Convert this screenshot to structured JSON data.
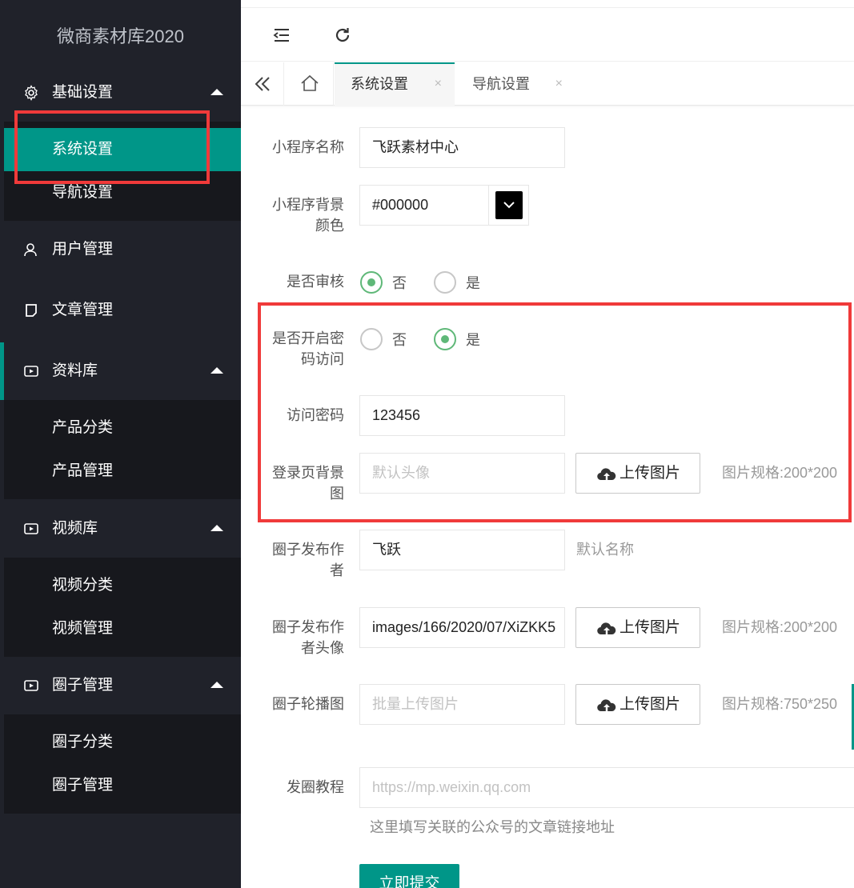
{
  "app": {
    "title": "微商素材库2020"
  },
  "sidebar": {
    "groups": [
      {
        "label": "基础设置",
        "items": [
          {
            "label": "系统设置"
          },
          {
            "label": "导航设置"
          }
        ]
      },
      {
        "label": "用户管理"
      },
      {
        "label": "文章管理"
      },
      {
        "label": "资料库",
        "items": [
          {
            "label": "产品分类"
          },
          {
            "label": "产品管理"
          }
        ]
      },
      {
        "label": "视频库",
        "items": [
          {
            "label": "视频分类"
          },
          {
            "label": "视频管理"
          }
        ]
      },
      {
        "label": "圈子管理",
        "items": [
          {
            "label": "圈子分类"
          },
          {
            "label": "圈子管理"
          }
        ]
      }
    ]
  },
  "tabs": [
    {
      "label": "系统设置",
      "close": "×"
    },
    {
      "label": "导航设置",
      "close": "×"
    }
  ],
  "form": {
    "app_name": {
      "label": "小程序名称",
      "value": "飞跃素材中心"
    },
    "bg_color": {
      "label_line1": "小程序背景",
      "label_line2": "颜色",
      "value": "#000000"
    },
    "review": {
      "label": "是否审核",
      "options": [
        "否",
        "是"
      ],
      "selected": "否"
    },
    "password_access": {
      "label_line1": "是否开启密",
      "label_line2": "码访问",
      "options": [
        "否",
        "是"
      ],
      "selected": "是"
    },
    "access_password": {
      "label": "访问密码",
      "value": "123456"
    },
    "login_bg": {
      "label_line1": "登录页背景",
      "label_line2": "图",
      "placeholder": "默认头像",
      "button": "上传图片",
      "hint": "图片规格:200*200"
    },
    "circle_author": {
      "label_line1": "圈子发布作",
      "label_line2": "者",
      "value": "飞跃",
      "hint": "默认名称"
    },
    "circle_author_avatar": {
      "label_line1": "圈子发布作",
      "label_line2": "者头像",
      "value": "images/166/2020/07/XiZKK5",
      "button": "上传图片",
      "hint": "图片规格:200*200"
    },
    "circle_carousel": {
      "label": "圈子轮播图",
      "placeholder": "批量上传图片",
      "button": "上传图片",
      "hint": "图片规格:750*250"
    },
    "post_tutorial": {
      "label": "发圈教程",
      "placeholder": "https://mp.weixin.qq.com",
      "help": "这里填写关联的公众号的文章链接地址"
    },
    "submit": "立即提交"
  },
  "colors": {
    "accent": "#009688",
    "sidebar_bg": "#20222a",
    "sidebar_sub_bg": "#17181d",
    "highlight_box": "#f03a3a",
    "radio_on": "#5fb878"
  }
}
